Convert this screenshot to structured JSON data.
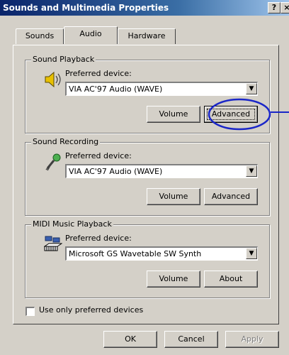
{
  "window": {
    "title": "Sounds and Multimedia Properties",
    "help_glyph": "?",
    "close_glyph": "×"
  },
  "tabs": [
    {
      "label": "Sounds"
    },
    {
      "label": "Audio"
    },
    {
      "label": "Hardware"
    }
  ],
  "playback": {
    "legend": "Sound Playback",
    "icon": "speaker-icon",
    "preferred_label": "Preferred device:",
    "device": "VIA AC'97 Audio (WAVE)",
    "volume_label": "Volume",
    "advanced_label": "Advanced"
  },
  "recording": {
    "legend": "Sound Recording",
    "icon": "microphone-icon",
    "preferred_label": "Preferred device:",
    "device": "VIA AC'97 Audio (WAVE)",
    "volume_label": "Volume",
    "advanced_label": "Advanced"
  },
  "midi": {
    "legend": "MIDI Music Playback",
    "icon": "midi-keyboard-icon",
    "preferred_label": "Preferred device:",
    "device": "Microsoft GS Wavetable SW Synth",
    "volume_label": "Volume",
    "about_label": "About"
  },
  "use_preferred_only": {
    "label": "Use only preferred devices",
    "checked": false
  },
  "footer": {
    "ok_label": "OK",
    "cancel_label": "Cancel",
    "apply_label": "Apply"
  },
  "colors": {
    "dialog_face": "#d4d0c8",
    "title_bar": "#0a246a",
    "annotation": "#1a26c8"
  }
}
